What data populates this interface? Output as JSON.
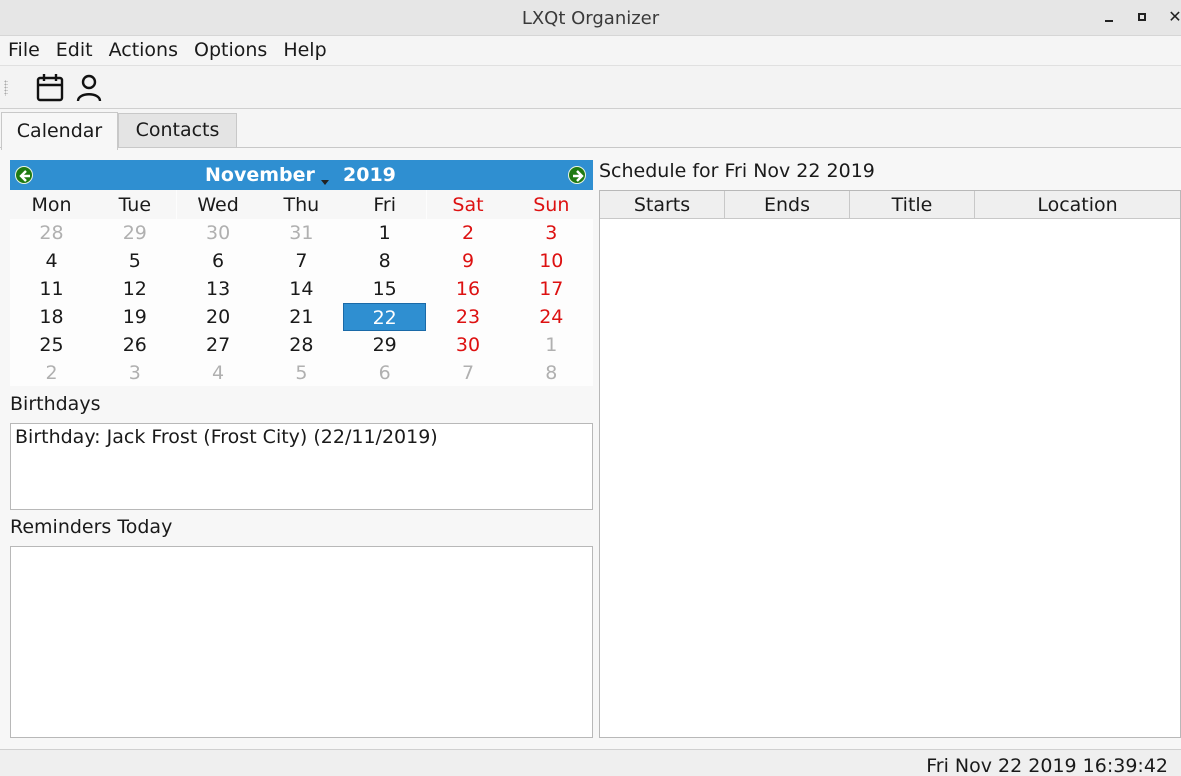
{
  "window": {
    "title": "LXQt Organizer"
  },
  "menu": [
    "File",
    "Edit",
    "Actions",
    "Options",
    "Help"
  ],
  "toolbar": {
    "icons": [
      "calendar-icon",
      "contact-icon"
    ]
  },
  "tabs": [
    "Calendar",
    "Contacts"
  ],
  "calendar": {
    "month": "November",
    "year": "2019",
    "weekdays": [
      "Mon",
      "Tue",
      "Wed",
      "Thu",
      "Fri",
      "Sat",
      "Sun"
    ],
    "weeks": [
      [
        "28",
        "29",
        "30",
        "31",
        "1",
        "2",
        "3"
      ],
      [
        "4",
        "5",
        "6",
        "7",
        "8",
        "9",
        "10"
      ],
      [
        "11",
        "12",
        "13",
        "14",
        "15",
        "16",
        "17"
      ],
      [
        "18",
        "19",
        "20",
        "21",
        "22",
        "23",
        "24"
      ],
      [
        "25",
        "26",
        "27",
        "28",
        "29",
        "30",
        "1"
      ],
      [
        "2",
        "3",
        "4",
        "5",
        "6",
        "7",
        "8"
      ]
    ],
    "selected": "22",
    "colors": {
      "header": "#2f8fd1",
      "weekend": "#d11111",
      "other_month": "#b0b0b0",
      "nav": "#1f7a12"
    }
  },
  "birthdays": {
    "label": "Birthdays",
    "items": [
      "Birthday: Jack Frost (Frost City) (22/11/2019)"
    ]
  },
  "reminders": {
    "label": "Reminders Today",
    "items": []
  },
  "schedule": {
    "label": "Schedule for Fri Nov 22 2019",
    "columns": [
      "Starts",
      "Ends",
      "Title",
      "Location"
    ],
    "rows": []
  },
  "status": {
    "datetime": "Fri Nov 22 2019 16:39:42"
  }
}
